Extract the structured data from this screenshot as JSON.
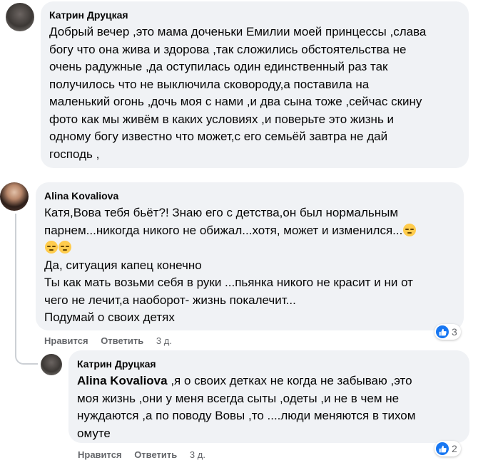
{
  "comments": [
    {
      "author": "Катрин Друцкая",
      "text": "Добрый вечер ,это мама доченьки Емилии моей принцессы ,слава\nбогу что она жива и здорова ,так сложились обстоятельства не\nочень радужные ,да оступилась один единственный раз так\nполучилось что не выключила сковороду,а поставила на\nмаленький огонь ,дочь моя с нами ,и два сына тоже ,сейчас скину\nфото как мы живём в каких условиях ,и поверьте это жизнь и\nодному богу известно что может,с его семьёй завтра не дай\nгосподь ,"
    },
    {
      "author": "Alina Kovaliova",
      "line1": "Катя,Вова тебя бьёт?! Знаю его с детства,он был нормальным",
      "line2": "парнем...никогда никого не обижал...хотя, может и изменился...",
      "rest": "Да, ситуация капец конечно\nТы как мать возьми себя в руки ...пьянка никого не красит и ни от\nчего не лечит,а наоборот- жизнь покалечит...\nПодумай о своих детях",
      "emoji_name": "pensive-face",
      "like_label": "Нравится",
      "reply_label": "Ответить",
      "time": "3 д.",
      "reactions": "3"
    },
    {
      "author": "Катрин Друцкая",
      "mention": "Alina Kovaliova",
      "text": " ,я о своих детках не когда не забываю ,это\nмоя жизнь ,они у меня всегда сыты ,одеты ,и не в чем не\nнуждаются ,а по поводу Вовы ,то ....люди меняются в тихом\nомуте",
      "like_label": "Нравится",
      "reply_label": "Ответить",
      "time": "3 д.",
      "reactions": "2"
    }
  ],
  "colors": {
    "bubble": "#f0f2f5",
    "like_blue": "#1877f2",
    "meta_gray": "#65676b"
  }
}
